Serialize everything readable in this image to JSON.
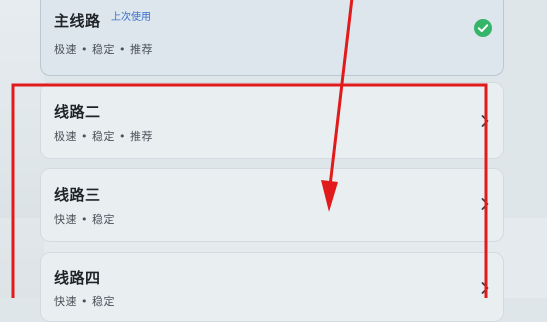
{
  "routes": [
    {
      "title": "主线路",
      "badge": "上次使用",
      "subtitle": "极速 • 稳定 • 推荐",
      "selected": true,
      "icon": "check-circle-icon"
    },
    {
      "title": "线路二",
      "subtitle": "极速 • 稳定 • 推荐",
      "selected": false,
      "icon": "chevron-right-icon"
    },
    {
      "title": "线路三",
      "subtitle": "快速 • 稳定",
      "selected": false,
      "icon": "chevron-right-icon"
    },
    {
      "title": "线路四",
      "subtitle": "快速 • 稳定",
      "selected": false,
      "icon": "chevron-right-icon"
    }
  ],
  "colors": {
    "check": "#34b56a",
    "annotation": "#e11b1b",
    "badge_text": "#3a6fc9"
  },
  "annotation": {
    "type": "red-highlight-box-with-arrow",
    "highlighted_items": [
      "线路二",
      "线路三",
      "线路四"
    ]
  }
}
